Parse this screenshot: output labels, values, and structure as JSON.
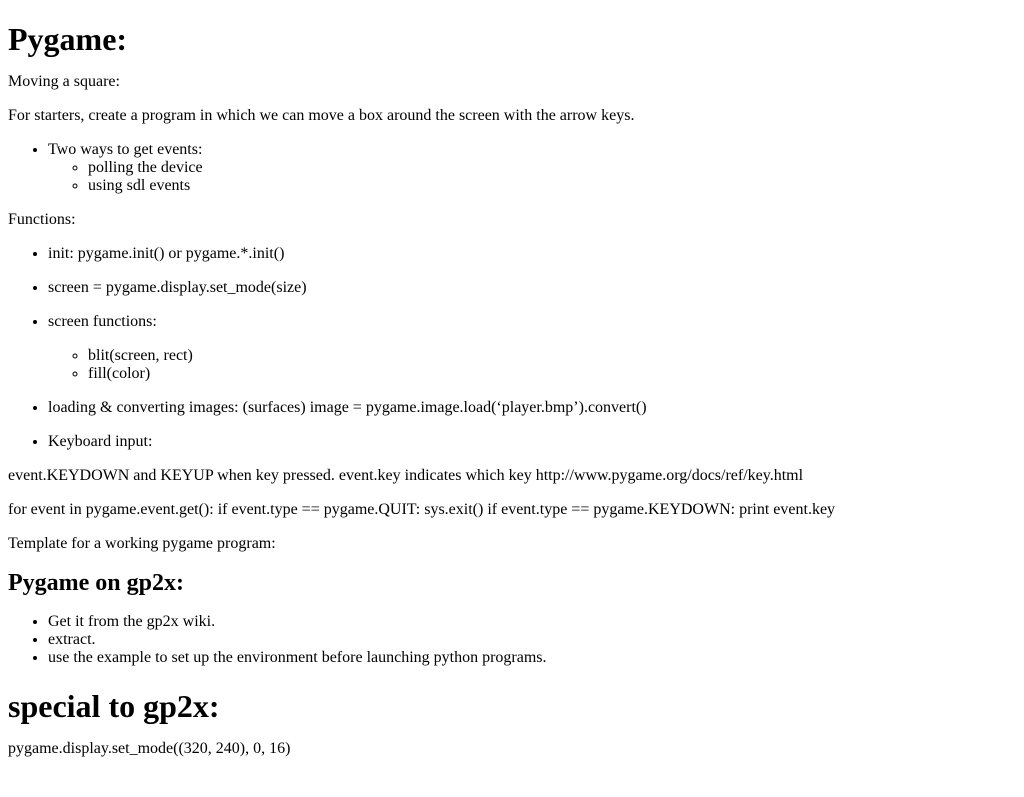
{
  "title": "Pygame:",
  "intro": {
    "subtitle": "Moving a square:",
    "text": "For starters, create a program in which we can move a box around the screen with the arrow keys."
  },
  "events_list": {
    "item": "Two ways to get events:",
    "subitems": [
      "polling the device",
      "using sdl events"
    ]
  },
  "functions_heading": "Functions:",
  "functions": {
    "init": "init: pygame.init() or pygame.*.init()",
    "screen": "screen = pygame.display.set_mode(size)",
    "screen_functions": "screen functions:",
    "screen_subitems": [
      "blit(screen, rect)",
      "fill(color)"
    ],
    "images": "loading & converting images: (surfaces) image = pygame.image.load(‘player.bmp’).convert()",
    "keyboard": "Keyboard input:"
  },
  "keydown_text": "event.KEYDOWN and KEYUP when key pressed. event.key indicates which key http://www.pygame.org/docs/ref/key.html",
  "loop_text": "for event in pygame.event.get(): if event.type == pygame.QUIT: sys.exit() if event.type == pygame.KEYDOWN: print event.key",
  "template_text": "Template for a working pygame program:",
  "gp2x_heading": "Pygame on gp2x:",
  "gp2x_items": [
    "Get it from the gp2x wiki.",
    "extract.",
    "use the example to set up the environment before launching python programs."
  ],
  "special_heading": "special to gp2x:",
  "special_text": "pygame.display.set_mode((320, 240), 0, 16)"
}
